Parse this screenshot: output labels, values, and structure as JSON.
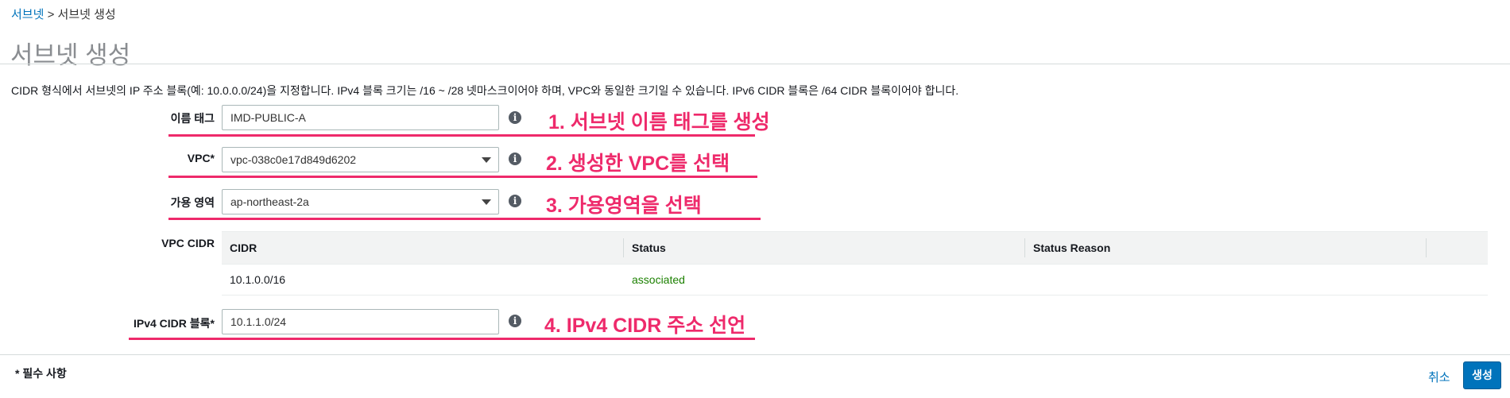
{
  "breadcrumb": {
    "link": "서브넷",
    "separator": ">",
    "current": "서브넷 생성"
  },
  "page_title": "서브넷 생성",
  "description": "CIDR 형식에서 서브넷의 IP 주소 블록(예: 10.0.0.0/24)을 지정합니다. IPv4 블록 크기는 /16 ~ /28 넷마스크이어야 하며, VPC와 동일한 크기일 수 있습니다. IPv6 CIDR 블록은 /64 CIDR 블록이어야 합니다.",
  "form": {
    "name_tag": {
      "label": "이름 태그",
      "value": "IMD-PUBLIC-A"
    },
    "vpc": {
      "label": "VPC*",
      "value": "vpc-038c0e17d849d6202"
    },
    "az": {
      "label": "가용 영역",
      "value": "ap-northeast-2a"
    },
    "vpc_cidr": {
      "label": "VPC CIDR",
      "columns": [
        "CIDR",
        "Status",
        "Status Reason"
      ],
      "rows": [
        {
          "cidr": "10.1.0.0/16",
          "status": "associated",
          "reason": ""
        }
      ]
    },
    "ipv4_cidr": {
      "label": "IPv4 CIDR 블록*",
      "value": "10.1.1.0/24"
    },
    "info_glyph": "i"
  },
  "annotations": [
    "1. 서브넷 이름 태그를 생성",
    "2. 생성한 VPC를 선택",
    "3. 가용영역을 선택",
    "4. IPv4 CIDR 주소 선언"
  ],
  "footer": {
    "required_note": "* 필수 사항",
    "cancel": "취소",
    "create": "생성"
  },
  "colors": {
    "link": "#0073bb",
    "annotation": "#ee2a6b",
    "status_ok": "#1d8102",
    "primary": "#0073bb"
  }
}
